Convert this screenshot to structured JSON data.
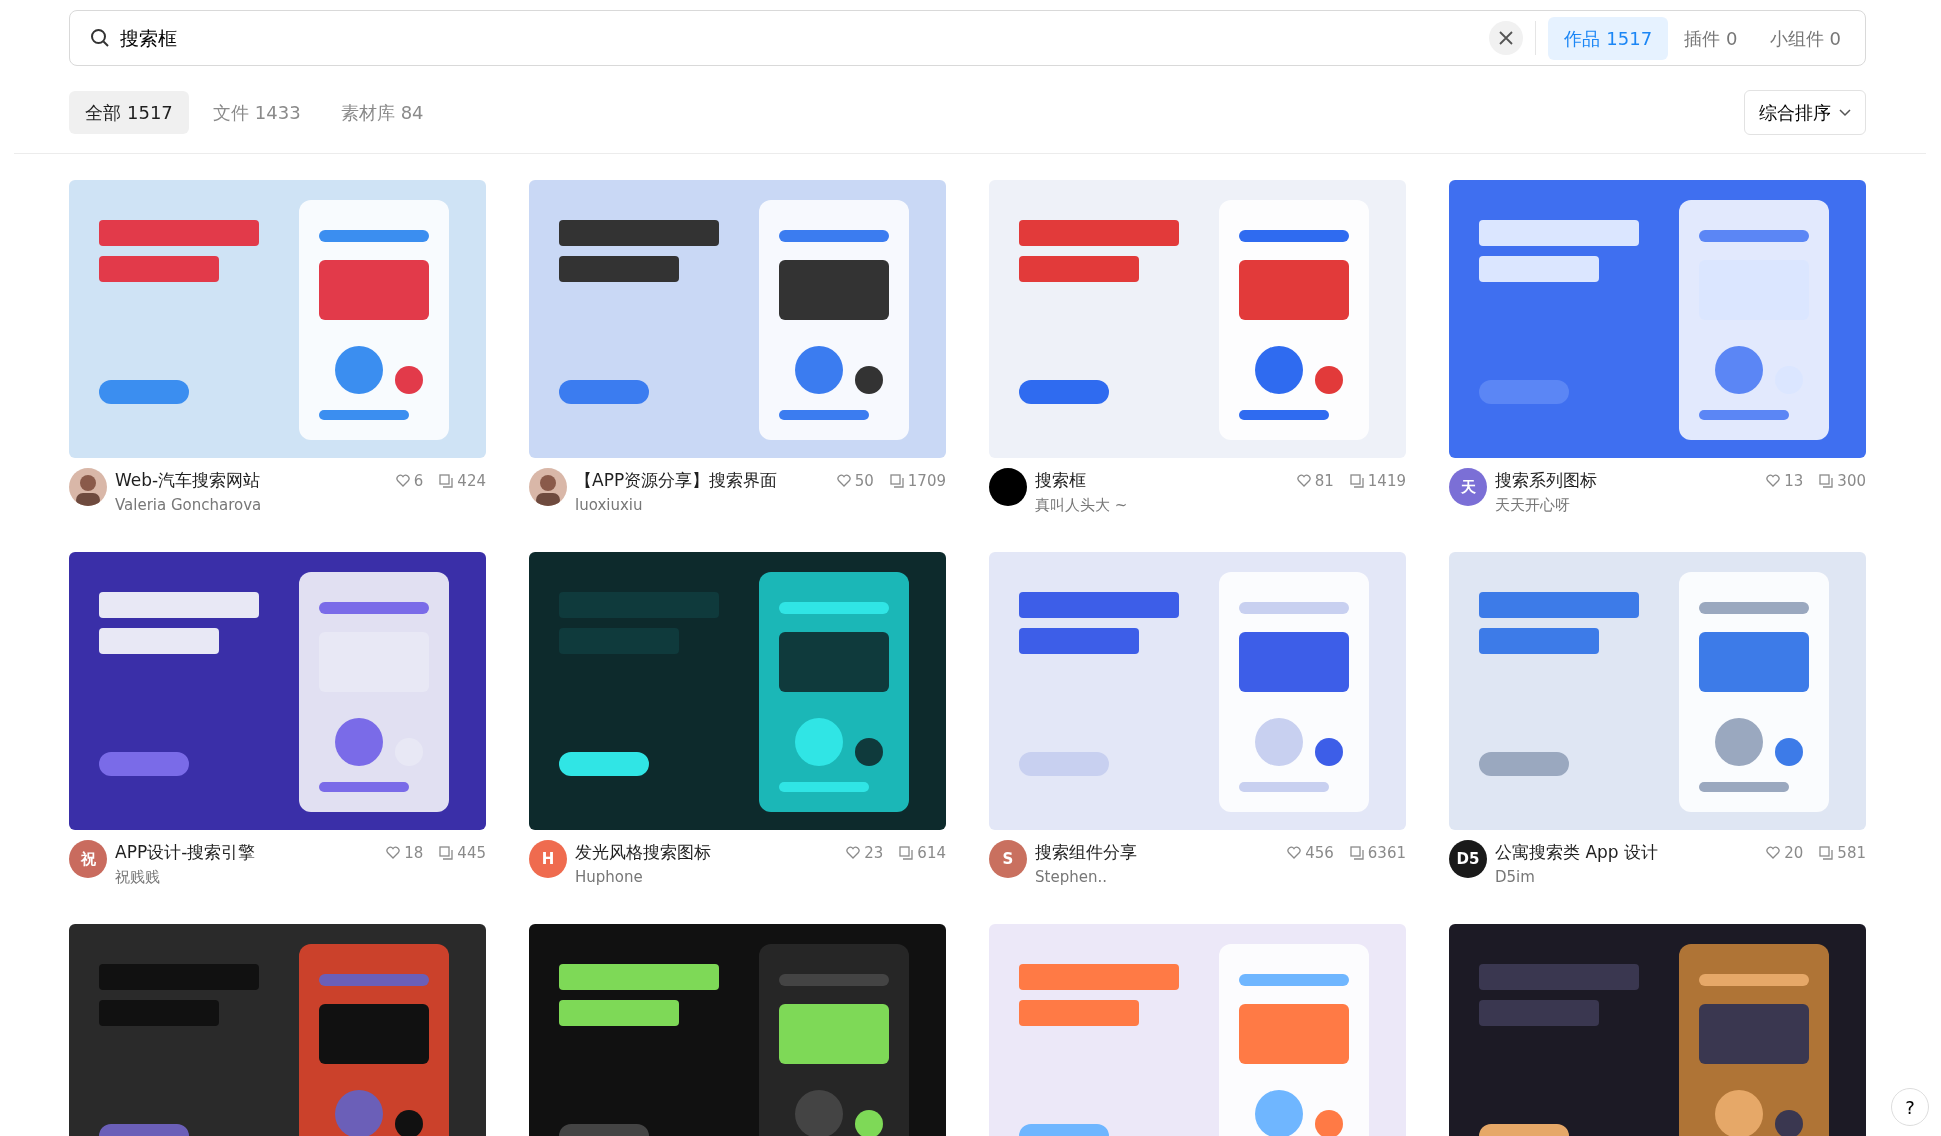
{
  "search": {
    "value": "搜索框"
  },
  "scope_tabs": [
    {
      "label": "作品",
      "count": "1517",
      "selected": true
    },
    {
      "label": "插件",
      "count": "0",
      "selected": false
    },
    {
      "label": "小组件",
      "count": "0",
      "selected": false
    }
  ],
  "filter_tabs": [
    {
      "label": "全部",
      "count": "1517",
      "selected": true
    },
    {
      "label": "文件",
      "count": "1433",
      "selected": false
    },
    {
      "label": "素材库",
      "count": "84",
      "selected": false
    }
  ],
  "sort": {
    "label": "综合排序"
  },
  "cards": [
    {
      "thumbnail": {
        "kind": "picture"
      },
      "title": "Web-汽车搜索网站",
      "author": "Valeria Goncharova",
      "avatar": {
        "kind": "picture"
      },
      "likes": "6",
      "views": "424"
    },
    {
      "thumbnail": {
        "kind": "picture"
      },
      "title": "【APP资源分享】搜索界面",
      "author": "luoxiuxiu",
      "avatar": {
        "kind": "picture"
      },
      "likes": "50",
      "views": "1709"
    },
    {
      "thumbnail": {
        "kind": "picture"
      },
      "title": "搜索框",
      "author": "真叫人头大 ~",
      "avatar": {
        "kind": "blank",
        "color": "#000000"
      },
      "likes": "81",
      "views": "1419"
    },
    {
      "thumbnail": {
        "kind": "picture"
      },
      "title": "搜索系列图标",
      "author": "天天开心呀",
      "avatar": {
        "kind": "letter",
        "text": "天",
        "color": "#7b6fd6"
      },
      "likes": "13",
      "views": "300"
    },
    {
      "thumbnail": {
        "kind": "picture"
      },
      "title": "APP设计-搜索引擎",
      "author": "祝贱贱",
      "avatar": {
        "kind": "letter",
        "text": "祝",
        "color": "#c96b5e"
      },
      "likes": "18",
      "views": "445"
    },
    {
      "thumbnail": {
        "kind": "picture"
      },
      "title": "发光风格搜索图标",
      "author": "Huphone",
      "avatar": {
        "kind": "letter",
        "text": "H",
        "color": "#ef6b4f"
      },
      "likes": "23",
      "views": "614"
    },
    {
      "thumbnail": {
        "kind": "picture"
      },
      "title": "搜索组件分享",
      "author": "Stephen..",
      "avatar": {
        "kind": "letter",
        "text": "S",
        "color": "#c9705f"
      },
      "likes": "456",
      "views": "6361"
    },
    {
      "thumbnail": {
        "kind": "picture"
      },
      "title": "公寓搜索类 App 设计",
      "author": "D5im",
      "avatar": {
        "kind": "letter",
        "text": "D5",
        "color": "#1a1a1a"
      },
      "likes": "20",
      "views": "581"
    },
    {
      "thumbnail": {
        "kind": "picture"
      }
    },
    {
      "thumbnail": {
        "kind": "picture"
      }
    },
    {
      "thumbnail": {
        "kind": "picture"
      }
    },
    {
      "thumbnail": {
        "kind": "picture"
      }
    }
  ],
  "help_button": {
    "label": "?"
  }
}
